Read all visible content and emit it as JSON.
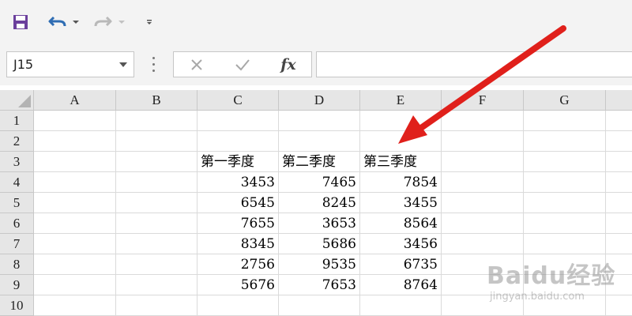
{
  "toolbar": {
    "icons": [
      "save-icon",
      "undo-icon",
      "undo-dropdown-icon",
      "redo-icon",
      "redo-dropdown-icon",
      "customize-toolbar-icon"
    ],
    "accent_color": "#6b3f9c",
    "undo_color": "#2f6db3"
  },
  "formula_bar": {
    "name_box_value": "J15",
    "fx_label": "fx",
    "formula_value": ""
  },
  "sheet": {
    "columns": [
      "A",
      "B",
      "C",
      "D",
      "E",
      "F",
      "G"
    ],
    "rows": [
      "1",
      "2",
      "3",
      "4",
      "5",
      "6",
      "7",
      "8",
      "9",
      "10"
    ],
    "headers": [
      "第一季度",
      "第二季度",
      "第三季度"
    ],
    "data": [
      [
        "3453",
        "7465",
        "7854"
      ],
      [
        "6545",
        "8245",
        "3455"
      ],
      [
        "7655",
        "3653",
        "8564"
      ],
      [
        "8345",
        "5686",
        "3456"
      ],
      [
        "2756",
        "9535",
        "6735"
      ],
      [
        "5676",
        "7653",
        "8764"
      ]
    ]
  },
  "annotation": {
    "arrow_color": "#e0201b"
  },
  "watermark": {
    "logo": "Baidu经验",
    "url": "jingyan.baidu.com"
  }
}
